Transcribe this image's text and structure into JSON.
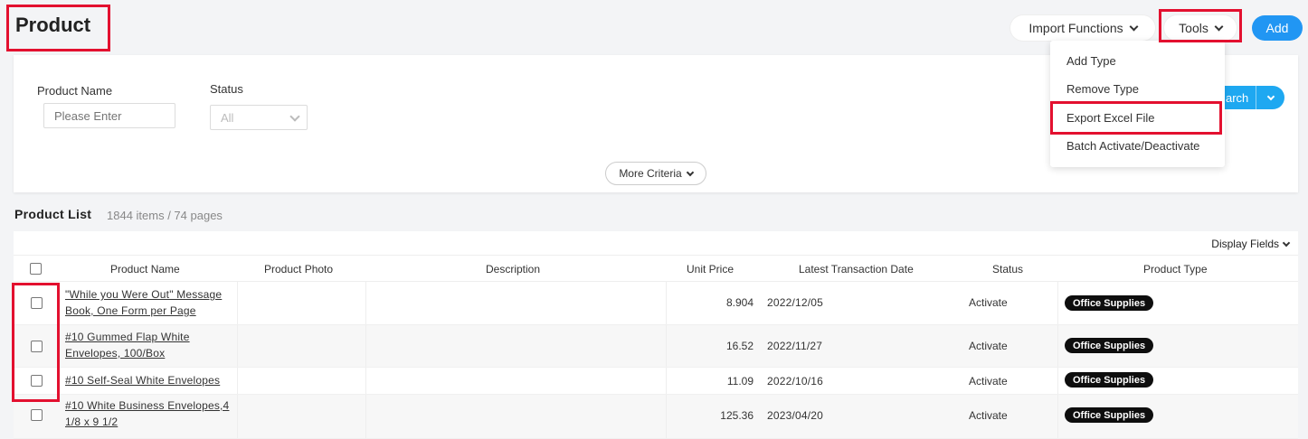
{
  "page": {
    "title": "Product"
  },
  "header": {
    "import_label": "Import Functions",
    "tools_label": "Tools",
    "add_label": "Add"
  },
  "tools_menu": {
    "items": [
      "Add Type",
      "Remove Type",
      "Export Excel File",
      "Batch Activate/Deactivate"
    ]
  },
  "filters": {
    "product_name_label": "Product Name",
    "product_name_placeholder": "Please Enter",
    "status_label": "Status",
    "status_value": "All",
    "more_criteria_label": "More Criteria",
    "search_label": "arch"
  },
  "list": {
    "title": "Product List",
    "count": "1844 items / 74 pages",
    "display_fields_label": "Display Fields",
    "columns": [
      "Product Name",
      "Product Photo",
      "Description",
      "Unit Price",
      "Latest Transaction Date",
      "Status",
      "Product Type"
    ],
    "rows": [
      {
        "name": "\"While you Were Out\" Message Book, One Form per Page",
        "price": "8.904",
        "date": "2022/12/05",
        "status": "Activate",
        "type": "Office Supplies"
      },
      {
        "name": "#10 Gummed Flap White Envelopes, 100/Box",
        "price": "16.52",
        "date": "2022/11/27",
        "status": "Activate",
        "type": "Office Supplies"
      },
      {
        "name": "#10 Self-Seal White Envelopes",
        "price": "11.09",
        "date": "2022/10/16",
        "status": "Activate",
        "type": "Office Supplies"
      },
      {
        "name": "#10 White Business Envelopes,4 1/8 x 9 1/2",
        "price": "125.36",
        "date": "2023/04/20",
        "status": "Activate",
        "type": "Office Supplies"
      }
    ]
  },
  "colors": {
    "accent": "#2196f3",
    "highlight": "#e3102f",
    "tag_bg": "#0e0e0e"
  }
}
